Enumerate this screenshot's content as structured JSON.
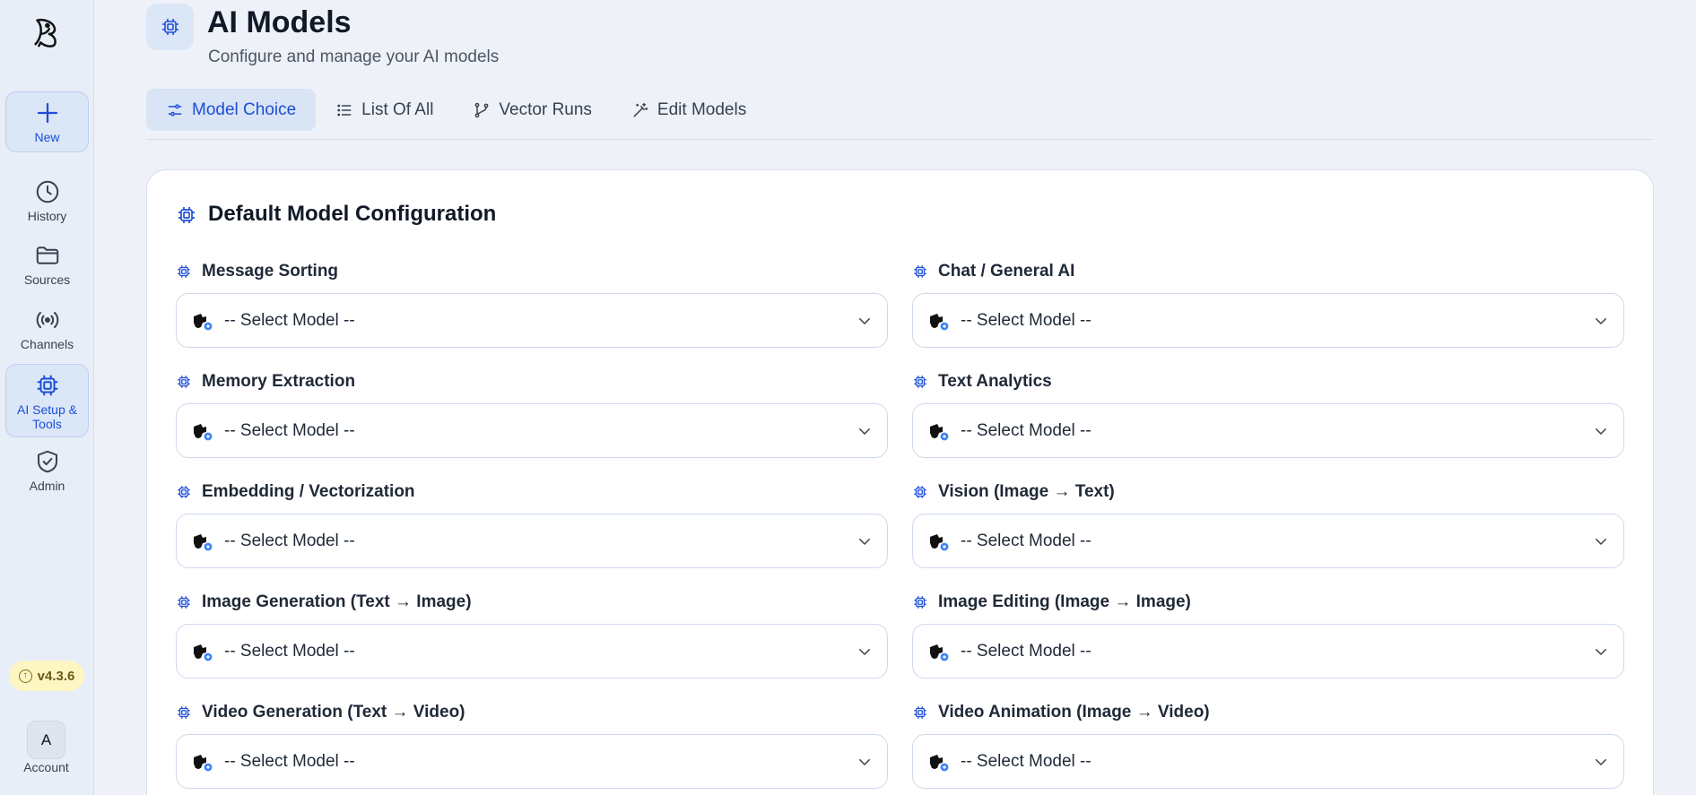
{
  "sidebar": {
    "items": [
      {
        "label": "New"
      },
      {
        "label": "History"
      },
      {
        "label": "Sources"
      },
      {
        "label": "Channels"
      },
      {
        "label": "AI Setup & Tools"
      },
      {
        "label": "Admin"
      }
    ],
    "version": "v4.3.6",
    "avatar_initial": "A",
    "account_label": "Account"
  },
  "header": {
    "title": "AI Models",
    "subtitle": "Configure and manage your AI models"
  },
  "tabs": [
    {
      "label": "Model Choice"
    },
    {
      "label": "List Of All"
    },
    {
      "label": "Vector Runs"
    },
    {
      "label": "Edit Models"
    }
  ],
  "card": {
    "title": "Default Model Configuration",
    "fields": [
      {
        "label": "Message Sorting",
        "value": "-- Select Model --"
      },
      {
        "label": "Chat / General AI",
        "value": "-- Select Model --"
      },
      {
        "label": "Memory Extraction",
        "value": "-- Select Model --"
      },
      {
        "label": "Text Analytics",
        "value": "-- Select Model --"
      },
      {
        "label": "Embedding / Vectorization",
        "value": "-- Select Model --"
      },
      {
        "label": "Vision (Image → Text)",
        "value": "-- Select Model --"
      },
      {
        "label": "Image Generation (Text → Image)",
        "value": "-- Select Model --"
      },
      {
        "label": "Image Editing (Image → Image)",
        "value": "-- Select Model --"
      },
      {
        "label": "Video Generation (Text → Video)",
        "value": "-- Select Model --"
      },
      {
        "label": "Video Animation (Image → Video)",
        "value": "-- Select Model --"
      }
    ]
  },
  "colors": {
    "accent": "#1d4ed8",
    "active_bg": "#dbe6f7",
    "page_bg": "#eef2f8",
    "badge_bg": "#fdf6c3"
  }
}
